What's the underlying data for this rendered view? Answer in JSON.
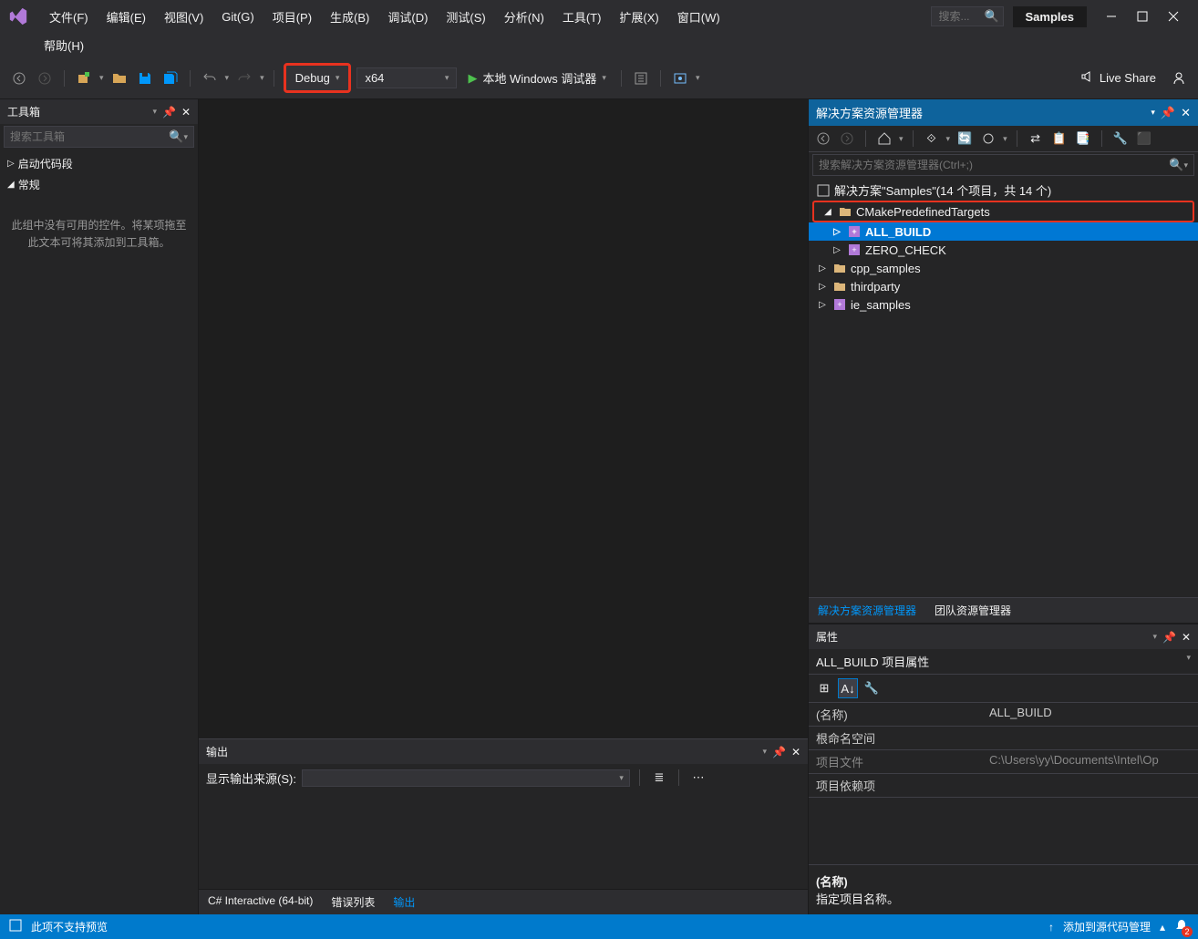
{
  "menu": {
    "file": "文件(F)",
    "edit": "编辑(E)",
    "view": "视图(V)",
    "git": "Git(G)",
    "project": "项目(P)",
    "build": "生成(B)",
    "debug": "调试(D)",
    "test": "测试(S)",
    "analyze": "分析(N)",
    "tools": "工具(T)",
    "extensions": "扩展(X)",
    "window": "窗口(W)",
    "help": "帮助(H)"
  },
  "search_placeholder": "搜索...",
  "solution_name": "Samples",
  "toolbar": {
    "config": "Debug",
    "platform": "x64",
    "debugger": "本地 Windows 调试器",
    "live_share": "Live Share"
  },
  "toolbox": {
    "title": "工具箱",
    "search_placeholder": "搜索工具箱",
    "items": [
      "启动代码段",
      "常规"
    ],
    "empty_text": "此组中没有可用的控件。将某项拖至此文本可将其添加到工具箱。"
  },
  "output": {
    "title": "输出",
    "source_label": "显示输出来源(S):"
  },
  "bottom_tabs": {
    "interactive": "C# Interactive (64-bit)",
    "error_list": "错误列表",
    "output": "输出"
  },
  "solution_explorer": {
    "title": "解决方案资源管理器",
    "search_placeholder": "搜索解决方案资源管理器(Ctrl+;)",
    "solution": "解决方案\"Samples\"(14 个项目，共 14 个)",
    "tree": {
      "cmake_targets": "CMakePredefinedTargets",
      "all_build": "ALL_BUILD",
      "zero_check": "ZERO_CHECK",
      "cpp_samples": "cpp_samples",
      "thirdparty": "thirdparty",
      "ie_samples": "ie_samples"
    },
    "tabs": {
      "sol": "解决方案资源管理器",
      "team": "团队资源管理器"
    }
  },
  "properties": {
    "title": "属性",
    "object": "ALL_BUILD 项目属性",
    "rows": {
      "name_label": "(名称)",
      "name_value": "ALL_BUILD",
      "namespace_label": "根命名空间",
      "namespace_value": "",
      "file_label": "项目文件",
      "file_value": "C:\\Users\\yy\\Documents\\Intel\\Op",
      "deps_label": "项目依赖项",
      "deps_value": ""
    },
    "desc_title": "(名称)",
    "desc_text": "指定项目名称。"
  },
  "statusbar": {
    "preview": "此项不支持预览",
    "source_control": "添加到源代码管理",
    "notif_count": "2"
  }
}
